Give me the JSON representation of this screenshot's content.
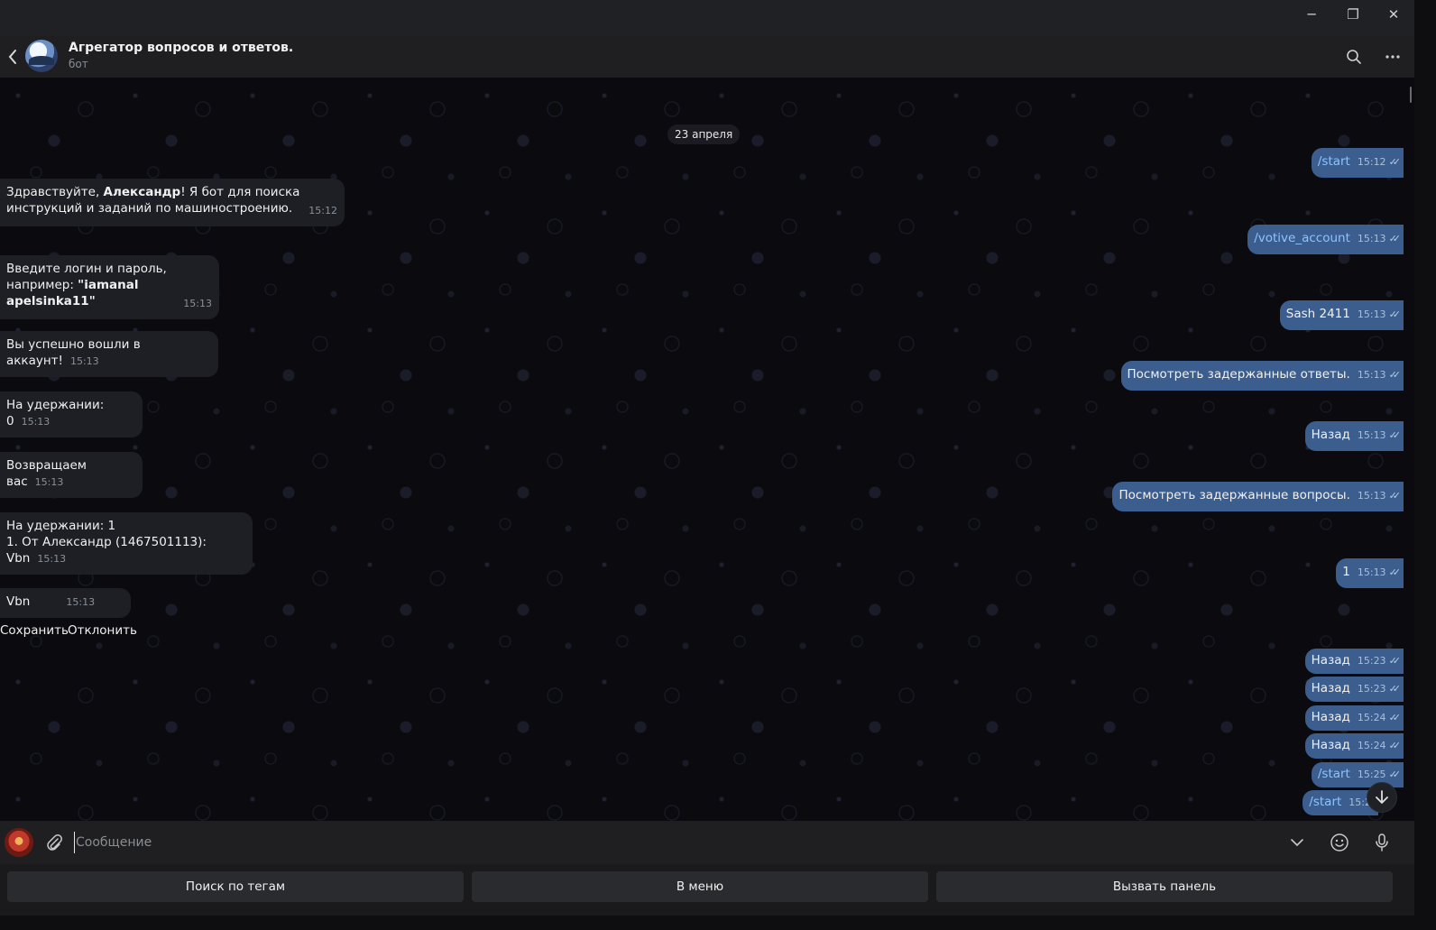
{
  "window": {
    "minimize": "─",
    "restore": "❐",
    "close": "✕"
  },
  "header": {
    "title": "Агрегатор вопросов и ответов.",
    "subtitle": "бот"
  },
  "chat": {
    "date": "23 апреля",
    "incoming": [
      {
        "pre": "Здравствуйте, ",
        "bold": "Александр",
        "post": "! Я бот для поиска инструкций и заданий по машиностроению.",
        "time": "15:12"
      },
      {
        "pre": "Введите логин и пароль, например: ",
        "bold": "\"iamanal apelsinka11\"",
        "post": "",
        "time": "15:13"
      },
      {
        "pre": "Вы успешно вошли в аккаунт!",
        "bold": "",
        "post": "",
        "time": "15:13"
      },
      {
        "pre": "На удержании: 0",
        "bold": "",
        "post": "",
        "time": "15:13"
      },
      {
        "pre": "Возвращаем вас",
        "bold": "",
        "post": "",
        "time": "15:13"
      },
      {
        "pre": "На удержании: 1",
        "bold": "",
        "post": "1. От Александр (1467501113): Vbn",
        "time": "15:13"
      },
      {
        "pre": "Vbn",
        "bold": "",
        "post": "",
        "time": "15:13"
      }
    ],
    "inline_buttons": {
      "save": "Сохранить",
      "reject": "Отклонить"
    },
    "outgoing": [
      {
        "text": "/start",
        "time": "15:12",
        "cmd": true
      },
      {
        "text": "/votive_account",
        "time": "15:13",
        "cmd": true
      },
      {
        "text": "Sash 2411",
        "time": "15:13",
        "cmd": false
      },
      {
        "text": "Посмотреть задержанные ответы.",
        "time": "15:13",
        "cmd": false
      },
      {
        "text": "Назад",
        "time": "15:13",
        "cmd": false
      },
      {
        "text": "Посмотреть задержанные вопросы.",
        "time": "15:13",
        "cmd": false
      },
      {
        "text": "1",
        "time": "15:13",
        "cmd": false
      },
      {
        "text": "Назад",
        "time": "15:23",
        "cmd": false
      },
      {
        "text": "Назад",
        "time": "15:23",
        "cmd": false
      },
      {
        "text": "Назад",
        "time": "15:24",
        "cmd": false
      },
      {
        "text": "Назад",
        "time": "15:24",
        "cmd": false
      },
      {
        "text": "/start",
        "time": "15:25",
        "cmd": true
      },
      {
        "text": "/start",
        "time": "15:2",
        "cmd": true
      }
    ],
    "check_glyph": "✓✓"
  },
  "composer": {
    "placeholder": "Сообщение"
  },
  "keyboard": {
    "b1": "Поиск по тегам",
    "b2": "В меню",
    "b3": "Вызвать панель"
  },
  "colors": {
    "outgoing_bubble": "#3b5e8f",
    "incoming_bubble": "#1d1f24",
    "command_link": "#8cc3ff"
  }
}
